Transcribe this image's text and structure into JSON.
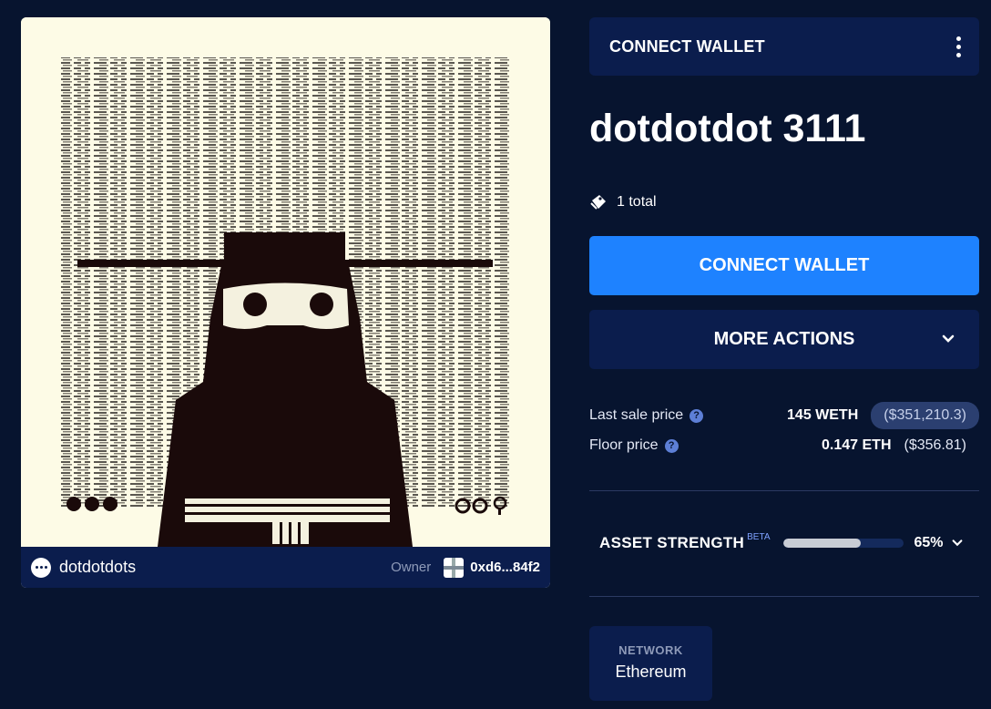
{
  "asset": {
    "title": "dotdotdot 3111",
    "supply": "1 total",
    "collection": "dotdotdots",
    "owner_label": "Owner",
    "owner_address": "0xd6...84f2"
  },
  "header": {
    "connect_wallet_label": "CONNECT WALLET",
    "menu_icon": "kebab-menu-icon"
  },
  "actions": {
    "connect_wallet": "CONNECT WALLET",
    "more_actions": "MORE ACTIONS"
  },
  "prices": {
    "last_sale_label": "Last sale price",
    "last_sale_value": "145 WETH",
    "last_sale_fiat": "($351,210.3)",
    "floor_label": "Floor price",
    "floor_value": "0.147 ETH",
    "floor_fiat": "($356.81)"
  },
  "strength": {
    "label": "ASSET STRENGTH",
    "badge": "BETA",
    "percent_text": "65%",
    "level": 0.65
  },
  "network": {
    "label": "NETWORK",
    "value": "Ethereum"
  },
  "colors": {
    "background": "#07142f",
    "panel": "#0b1d4d",
    "accent": "#1e82ff",
    "art_bg": "#fdfbe6",
    "art_figure": "#1a0a0a"
  }
}
